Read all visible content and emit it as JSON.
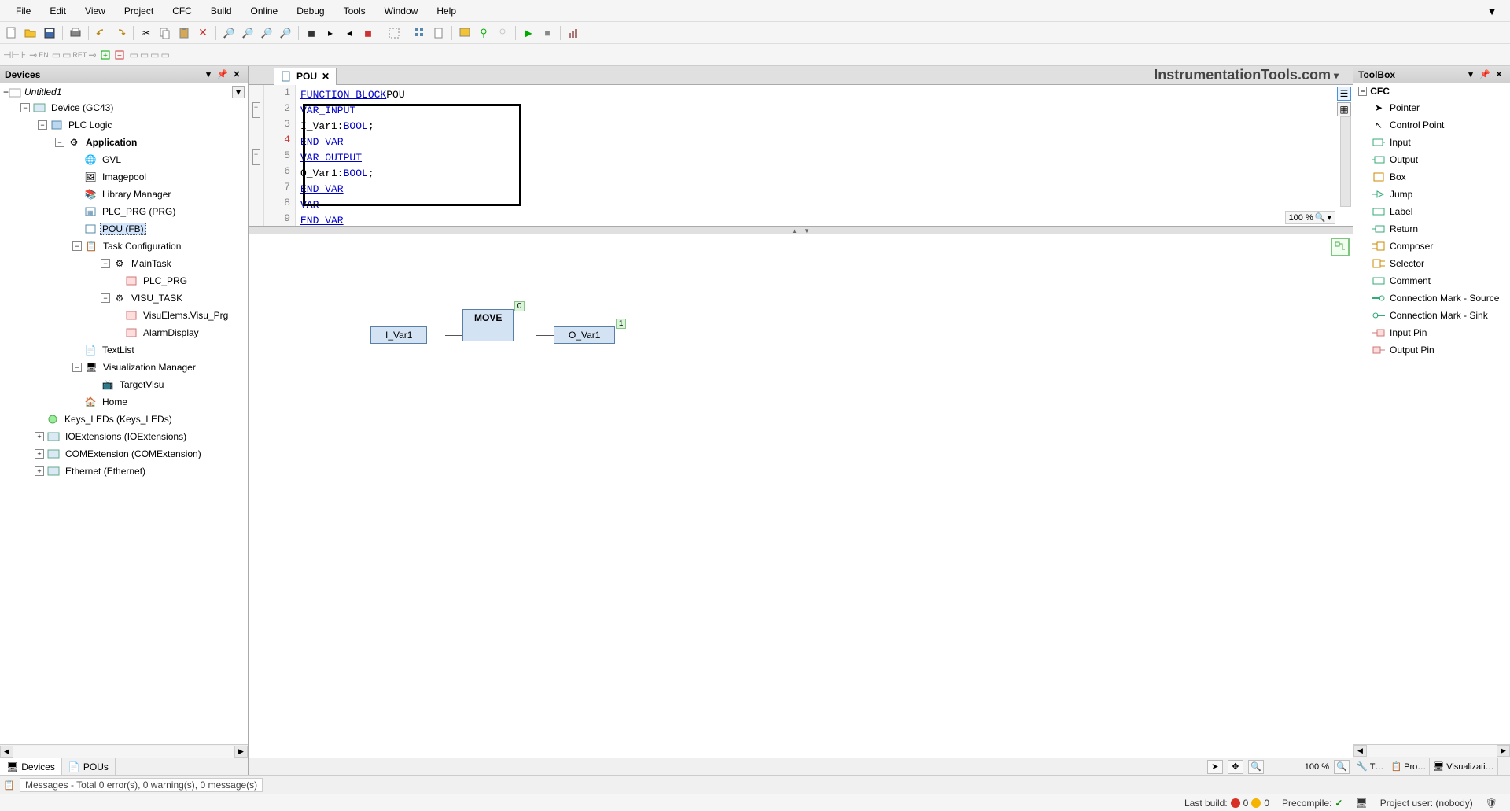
{
  "menu": {
    "file": "File",
    "edit": "Edit",
    "view": "View",
    "project": "Project",
    "cfc": "CFC",
    "build": "Build",
    "online": "Online",
    "debug": "Debug",
    "tools": "Tools",
    "window": "Window",
    "help": "Help"
  },
  "devices_panel": {
    "title": "Devices",
    "project": "Untitled1",
    "device": "Device (GC43)",
    "plc_logic": "PLC Logic",
    "application": "Application",
    "gvl": "GVL",
    "imagepool": "Imagepool",
    "library_manager": "Library Manager",
    "plc_prg": "PLC_PRG (PRG)",
    "pou_fb": "POU (FB)",
    "task_config": "Task Configuration",
    "main_task": "MainTask",
    "plc_prg_task": "PLC_PRG",
    "visu_task": "VISU_TASK",
    "visu_elems": "VisuElems.Visu_Prg",
    "alarm_display": "AlarmDisplay",
    "textlist": "TextList",
    "vis_manager": "Visualization Manager",
    "target_visu": "TargetVisu",
    "home": "Home",
    "keys_leds": "Keys_LEDs (Keys_LEDs)",
    "io_ext": "IOExtensions (IOExtensions)",
    "com_ext": "COMExtension (COMExtension)",
    "ethernet": "Ethernet (Ethernet)"
  },
  "bottom_tabs": {
    "devices": "Devices",
    "pous": "POUs"
  },
  "editor": {
    "tab_name": "POU",
    "watermark": "InstrumentationTools.com",
    "lines": {
      "l1a": "FUNCTION_BLOCK",
      "l1b": " POU",
      "l2": "VAR_INPUT",
      "l3a": "    I_Var1: ",
      "l3b": "BOOL",
      "l3c": ";",
      "l4": "END_VAR",
      "l5": "VAR_OUTPUT",
      "l6a": "    O_Var1: ",
      "l6b": "BOOL",
      "l6c": ";",
      "l7": "END_VAR",
      "l8": "VAR",
      "l9": "END_VAR"
    },
    "line_nums": [
      "1",
      "2",
      "3",
      "4",
      "5",
      "6",
      "7",
      "8",
      "9"
    ],
    "zoom": "100 %"
  },
  "diagram": {
    "input_var": "I_Var1",
    "move": "MOVE",
    "output_var": "O_Var1",
    "badge0": "0",
    "badge1": "1",
    "zoom": "100 %"
  },
  "toolbox": {
    "title": "ToolBox",
    "category": "CFC",
    "items": [
      "Pointer",
      "Control Point",
      "Input",
      "Output",
      "Box",
      "Jump",
      "Label",
      "Return",
      "Composer",
      "Selector",
      "Comment",
      "Connection Mark - Source",
      "Connection Mark - Sink",
      "Input Pin",
      "Output Pin"
    ]
  },
  "right_tabs": {
    "t": "T…",
    "pro": "Pro…",
    "vis": "Visualizati…"
  },
  "messages": "Messages - Total 0 error(s), 0 warning(s), 0 message(s)",
  "status": {
    "last_build": "Last build:",
    "build_err": "0",
    "build_warn": "0",
    "precompile": "Precompile:",
    "project_user": "Project user: (nobody)"
  }
}
